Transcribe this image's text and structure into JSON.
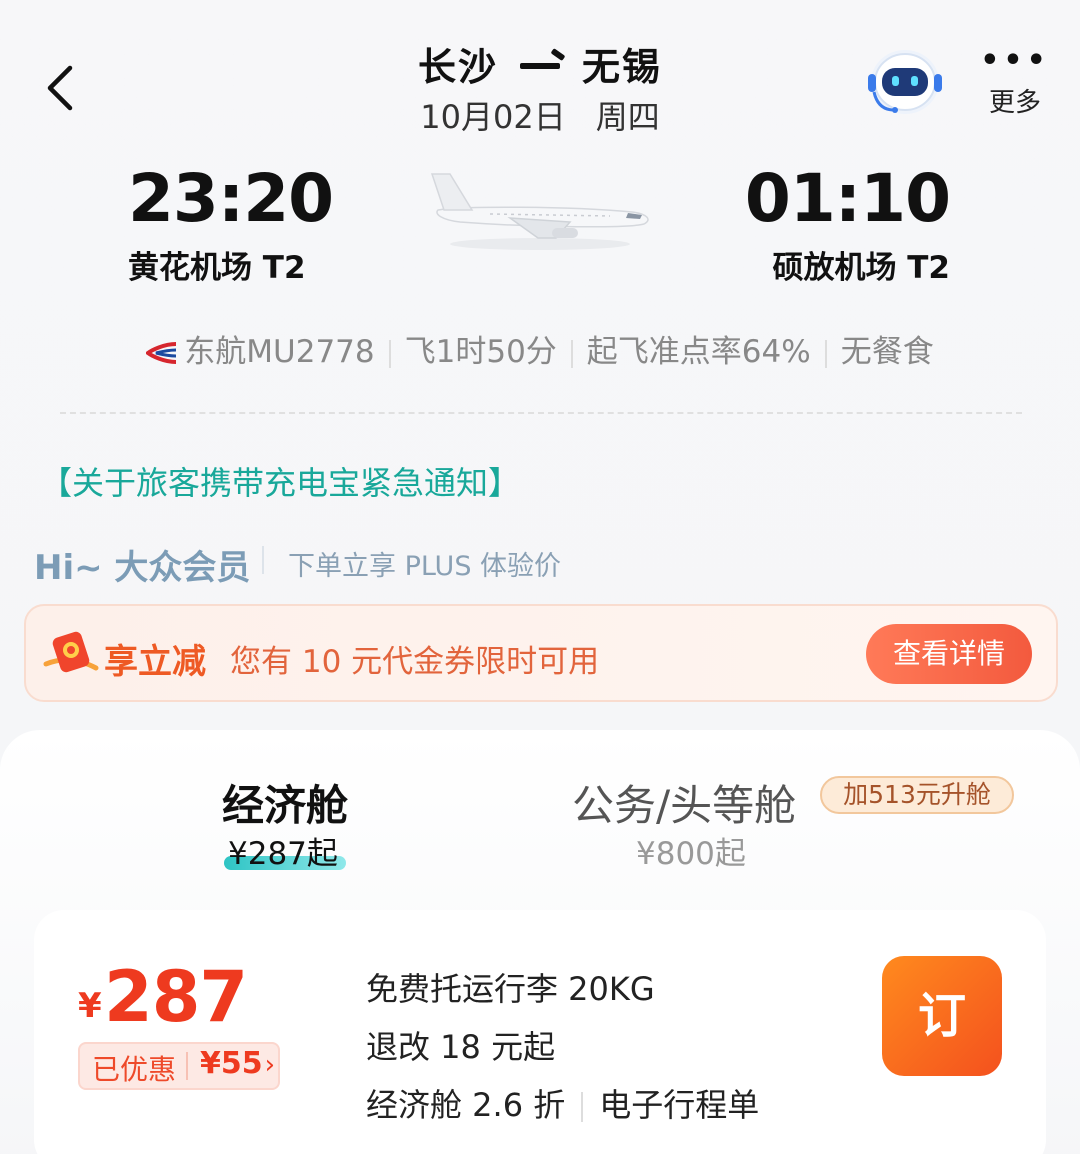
{
  "header": {
    "origin": "长沙",
    "destination": "无锡",
    "date": "10月02日",
    "weekday": "周四",
    "more_label": "更多"
  },
  "flight": {
    "dep_time": "23:20",
    "dep_airport": "黄花机场 T2",
    "arr_time": "01:10",
    "arr_airport": "硕放机场 T2",
    "info": [
      "东航MU2778",
      "飞1时50分",
      "起飞准点率64%",
      "无餐食"
    ]
  },
  "notice": "【关于旅客携带充电宝紧急通知】",
  "member": {
    "greeting": "Hi~ 大众会员",
    "benefit": "下单立享 PLUS 体验价"
  },
  "coupon": {
    "title": "享立减",
    "text": "您有 10 元代金券限时可用",
    "button": "查看详情"
  },
  "cabins": {
    "economy": {
      "name": "经济舱",
      "price": "¥287起"
    },
    "business": {
      "name": "公务/头等舱",
      "price": "¥800起",
      "upgrade": "加513元升舱"
    }
  },
  "offer": {
    "currency": "¥",
    "price": "287",
    "discount_label": "已优惠",
    "discount_value": "¥55",
    "features": [
      "免费托运行李 20KG",
      "退改 18 元起"
    ],
    "fare_class": "经济舱 2.6 折",
    "itinerary": "电子行程单",
    "book_label": "订"
  },
  "colors": {
    "accent_teal": "#19a89a",
    "price_red": "#ee3a1f",
    "coupon_orange": "#ee5a24",
    "book_orange": "#f4511e"
  },
  "icons": [
    "back-chevron-icon",
    "robot-assistant-icon",
    "more-dots-icon",
    "airplane-icon",
    "airline-logo-icon",
    "coupon-icon"
  ]
}
